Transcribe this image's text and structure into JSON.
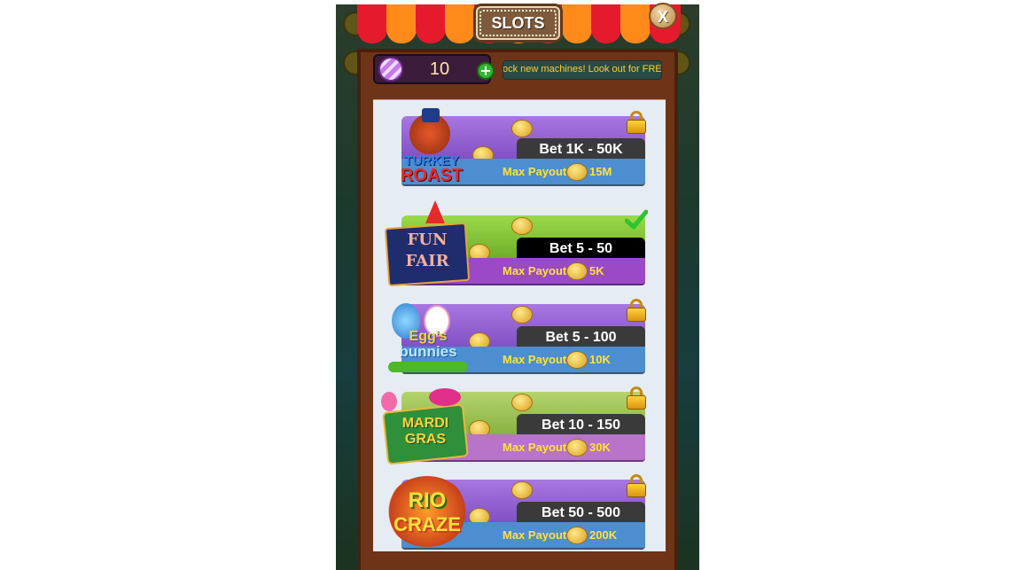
{
  "header": {
    "title": "SLOTS",
    "close_label": "X"
  },
  "currency": {
    "gem_icon": "candy-gem-icon",
    "gem_count": "10",
    "add_icon": "plus-icon"
  },
  "ticker": {
    "text": "ock new machines! Look out for FRE"
  },
  "machines": [
    {
      "logo_line1": "TURKEY",
      "logo_line2": "ROAST",
      "bet": "Bet 1K - 50K",
      "payout_label": "Max Payout",
      "payout_amount": "15M",
      "status": "locked",
      "colors": {
        "top": "#9b63d6",
        "bar": "#4d8ed0",
        "pill": "#3a3a3a"
      }
    },
    {
      "logo_line1": "FUN",
      "logo_line2": "FAIR",
      "bet": "Bet 5 - 50",
      "payout_label": "Max Payout",
      "payout_amount": "5K",
      "status": "unlocked",
      "colors": {
        "top": "#8ccf3a",
        "bar": "#9b49c7",
        "pill": "#000000"
      }
    },
    {
      "logo_line1": "Egg's",
      "logo_line2": "bunnies",
      "bet": "Bet 5 - 100",
      "payout_label": "Max Payout",
      "payout_amount": "10K",
      "status": "locked",
      "colors": {
        "top": "#9b63d6",
        "bar": "#4d8ed0",
        "pill": "#3a3a3a"
      }
    },
    {
      "logo_line1": "MARDI",
      "logo_line2": "GRAS",
      "bet": "Bet 10 - 150",
      "payout_label": "Max Payout",
      "payout_amount": "30K",
      "status": "locked",
      "colors": {
        "top": "#a5c95c",
        "bar": "#b774c9",
        "pill": "#3a3a3a"
      }
    },
    {
      "logo_line1": "RIO",
      "logo_line2": "CRAZE",
      "bet": "Bet 50 - 500",
      "payout_label": "Max Payout",
      "payout_amount": "200K",
      "status": "locked",
      "colors": {
        "top": "#9b63d6",
        "bar": "#4d8ed0",
        "pill": "#3a3a3a"
      }
    }
  ]
}
